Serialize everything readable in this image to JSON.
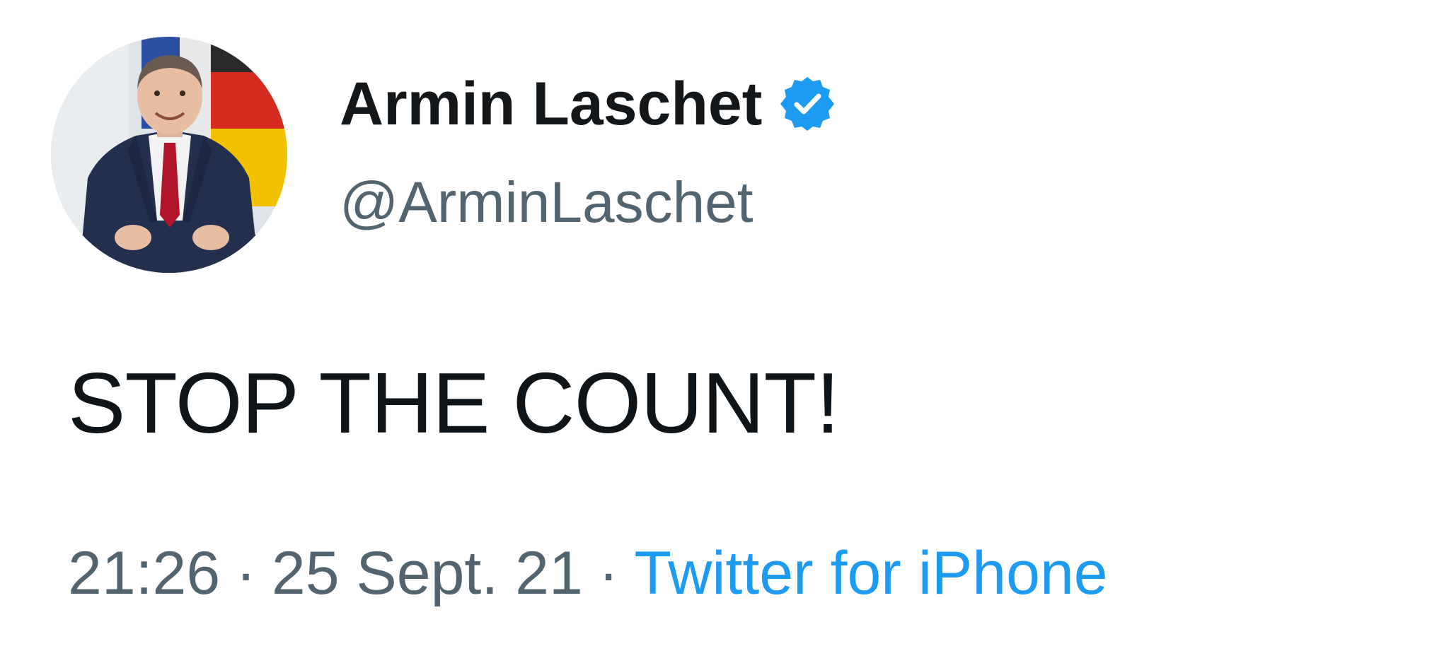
{
  "tweet": {
    "author": {
      "display_name": "Armin Laschet",
      "handle": "@ArminLaschet",
      "verified": true,
      "avatar_icon": "profile-photo"
    },
    "text": "STOP THE COUNT!",
    "meta": {
      "time": "21:26",
      "date": "25 Sept. 21",
      "separator": "·",
      "source": "Twitter for iPhone"
    }
  },
  "colors": {
    "name": "#14171a",
    "secondary_text": "#536471",
    "body_text": "#0f1419",
    "link_accent": "#1d9bf0",
    "verified_badge": "#1d9bf0"
  }
}
